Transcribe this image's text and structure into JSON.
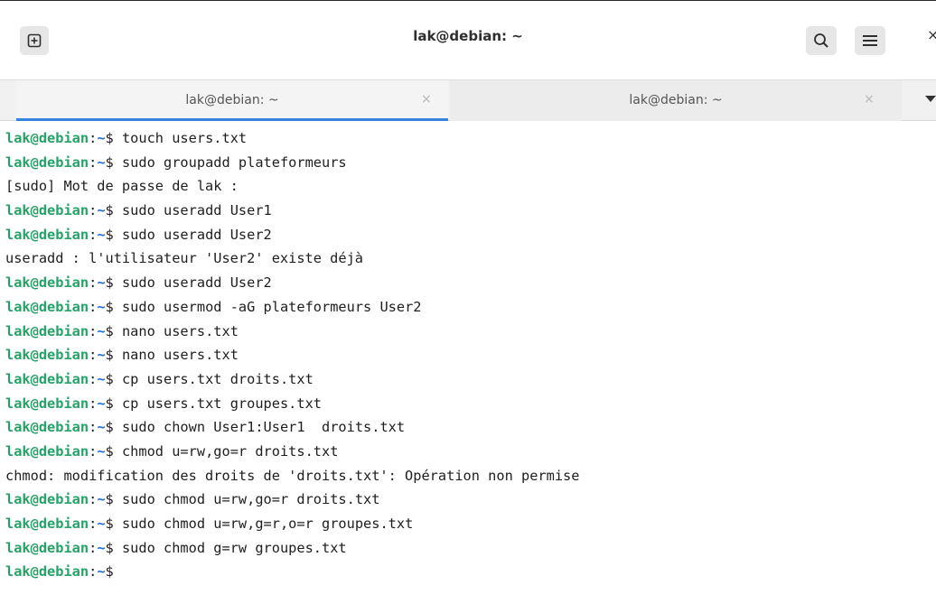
{
  "window": {
    "title": "lak@debian: ~",
    "close_glyph": "×"
  },
  "header": {
    "new_tab_icon": "new-tab-icon",
    "search_icon": "search-icon",
    "menu_icon": "hamburger-menu-icon"
  },
  "tabs": [
    {
      "label": "lak@debian: ~",
      "active": true,
      "close_glyph": "×"
    },
    {
      "label": "lak@debian: ~",
      "active": false,
      "close_glyph": "×"
    }
  ],
  "colors": {
    "accent": "#3584e4",
    "prompt_user": "#26a269",
    "prompt_path": "#1c71d8"
  },
  "terminal": {
    "prompt": {
      "user": "lak@debian",
      "sep": ":",
      "path": "~",
      "sym": "$ "
    },
    "lines": [
      {
        "type": "cmd",
        "text": "touch users.txt"
      },
      {
        "type": "cmd",
        "text": "sudo groupadd plateformeurs"
      },
      {
        "type": "out",
        "text": "[sudo] Mot de passe de lak :"
      },
      {
        "type": "cmd",
        "text": "sudo useradd User1"
      },
      {
        "type": "cmd",
        "text": "sudo useradd User2"
      },
      {
        "type": "out",
        "text": "useradd : l'utilisateur 'User2' existe déjà"
      },
      {
        "type": "cmd",
        "text": "sudo useradd User2"
      },
      {
        "type": "cmd",
        "text": "sudo usermod -aG plateformeurs User2"
      },
      {
        "type": "cmd",
        "text": "nano users.txt"
      },
      {
        "type": "cmd",
        "text": "nano users.txt"
      },
      {
        "type": "cmd",
        "text": "cp users.txt droits.txt"
      },
      {
        "type": "cmd",
        "text": "cp users.txt groupes.txt"
      },
      {
        "type": "cmd",
        "text": "sudo chown User1:User1  droits.txt"
      },
      {
        "type": "cmd",
        "text": "chmod u=rw,go=r droits.txt"
      },
      {
        "type": "out",
        "text": "chmod: modification des droits de 'droits.txt': Opération non permise"
      },
      {
        "type": "cmd",
        "text": "sudo chmod u=rw,go=r droits.txt"
      },
      {
        "type": "cmd",
        "text": "sudo chmod u=rw,g=r,o=r groupes.txt"
      },
      {
        "type": "cmd",
        "text": "sudo chmod g=rw groupes.txt"
      },
      {
        "type": "cmd",
        "text": ""
      }
    ]
  }
}
